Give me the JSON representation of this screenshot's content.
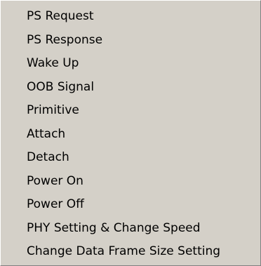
{
  "menu": {
    "items": [
      {
        "label": "PS Request"
      },
      {
        "label": "PS Response"
      },
      {
        "label": "Wake Up"
      },
      {
        "label": "OOB Signal"
      },
      {
        "label": "Primitive"
      },
      {
        "label": "Attach"
      },
      {
        "label": "Detach"
      },
      {
        "label": "Power On"
      },
      {
        "label": "Power Off"
      },
      {
        "label": "PHY Setting & Change Speed"
      },
      {
        "label": "Change Data Frame Size Setting"
      }
    ]
  },
  "colors": {
    "menu_background": "#d4d0c8",
    "text": "#000000"
  }
}
